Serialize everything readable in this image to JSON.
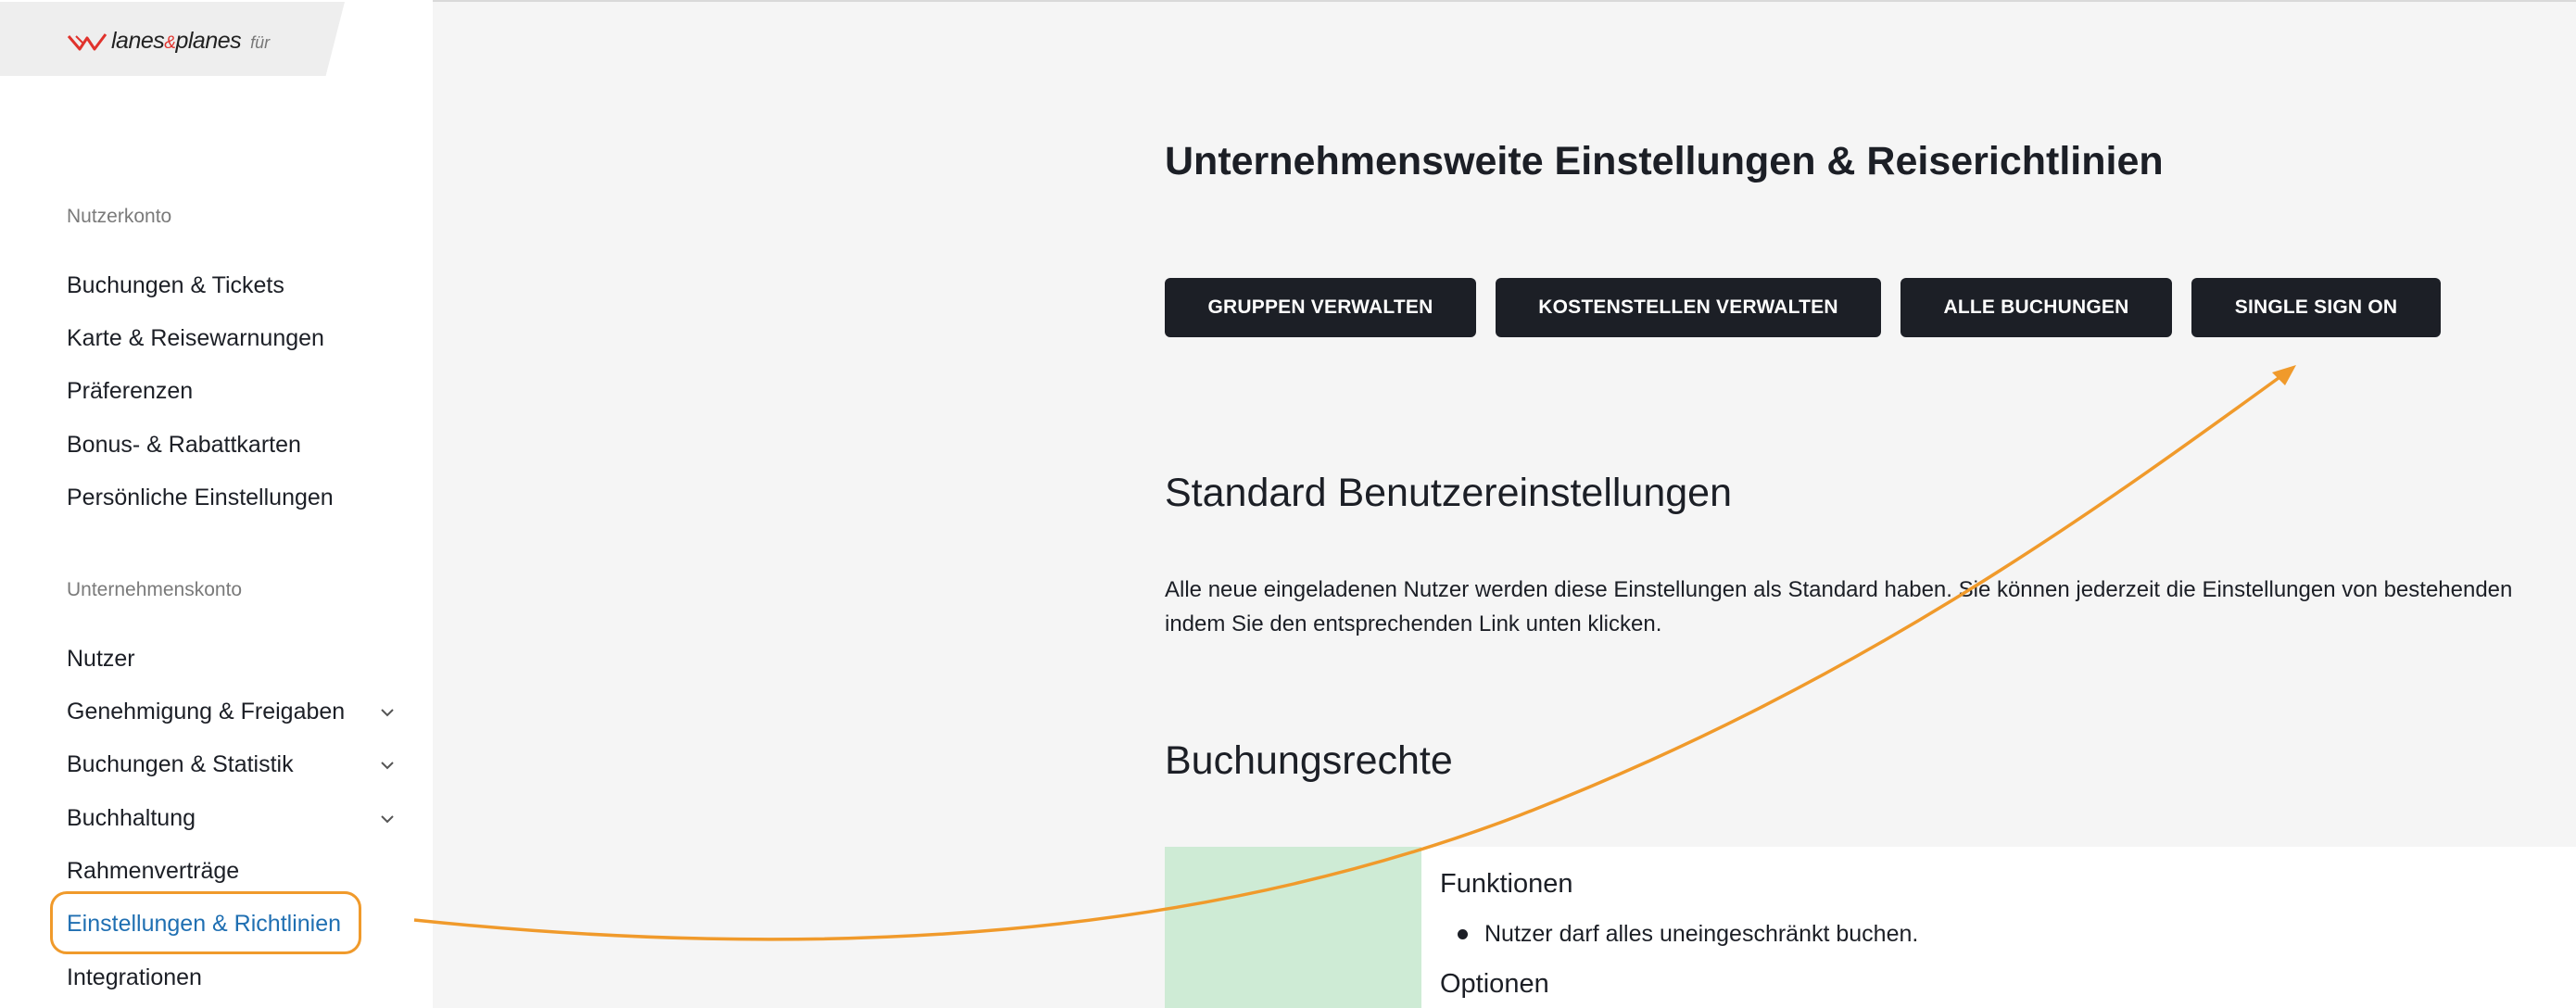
{
  "brand": {
    "name_part1": "lanes",
    "amp": "&",
    "name_part2": "planes",
    "suffix": "für"
  },
  "sidebar": {
    "sections": [
      {
        "label": "Nutzerkonto"
      },
      {
        "label": "Unternehmenskonto"
      }
    ],
    "items": [
      {
        "label": "Buchungen & Tickets"
      },
      {
        "label": "Karte & Reisewarnungen"
      },
      {
        "label": "Präferenzen"
      },
      {
        "label": "Bonus- & Rabattkarten"
      },
      {
        "label": "Persönliche Einstellungen"
      },
      {
        "label": "Nutzer"
      },
      {
        "label": "Genehmigung & Freigaben",
        "expandable": true
      },
      {
        "label": "Buchungen & Statistik",
        "expandable": true
      },
      {
        "label": "Buchhaltung",
        "expandable": true
      },
      {
        "label": "Rahmenverträge"
      },
      {
        "label": "Einstellungen & Richtlinien",
        "active": true
      },
      {
        "label": "Integrationen"
      }
    ]
  },
  "main": {
    "title": "Unternehmensweite Einstellungen & Reiserichtlinien",
    "buttons": [
      {
        "label": "GRUPPEN VERWALTEN"
      },
      {
        "label": "KOSTENSTELLEN VERWALTEN"
      },
      {
        "label": "ALLE BUCHUNGEN"
      },
      {
        "label": "SINGLE SIGN ON"
      }
    ],
    "standard": {
      "heading": "Standard Benutzereinstellungen",
      "line1": "Alle neue eingeladenen Nutzer werden diese Einstellungen als Standard haben. Sie können jederzeit die Einstellungen von bestehenden",
      "line2": "indem Sie den entsprechenden Link unten klicken."
    },
    "rights": {
      "heading": "Buchungsrechte",
      "card": {
        "functions_heading": "Funktionen",
        "function_item": "Nutzer darf alles uneingeschränkt buchen.",
        "options_heading": "Optionen"
      }
    }
  },
  "colors": {
    "accent": "#1f6fb2",
    "annotation": "#f09a2b",
    "button": "#1c1f26",
    "card_green": "#ceebd5",
    "brand_red": "#e0322c"
  }
}
